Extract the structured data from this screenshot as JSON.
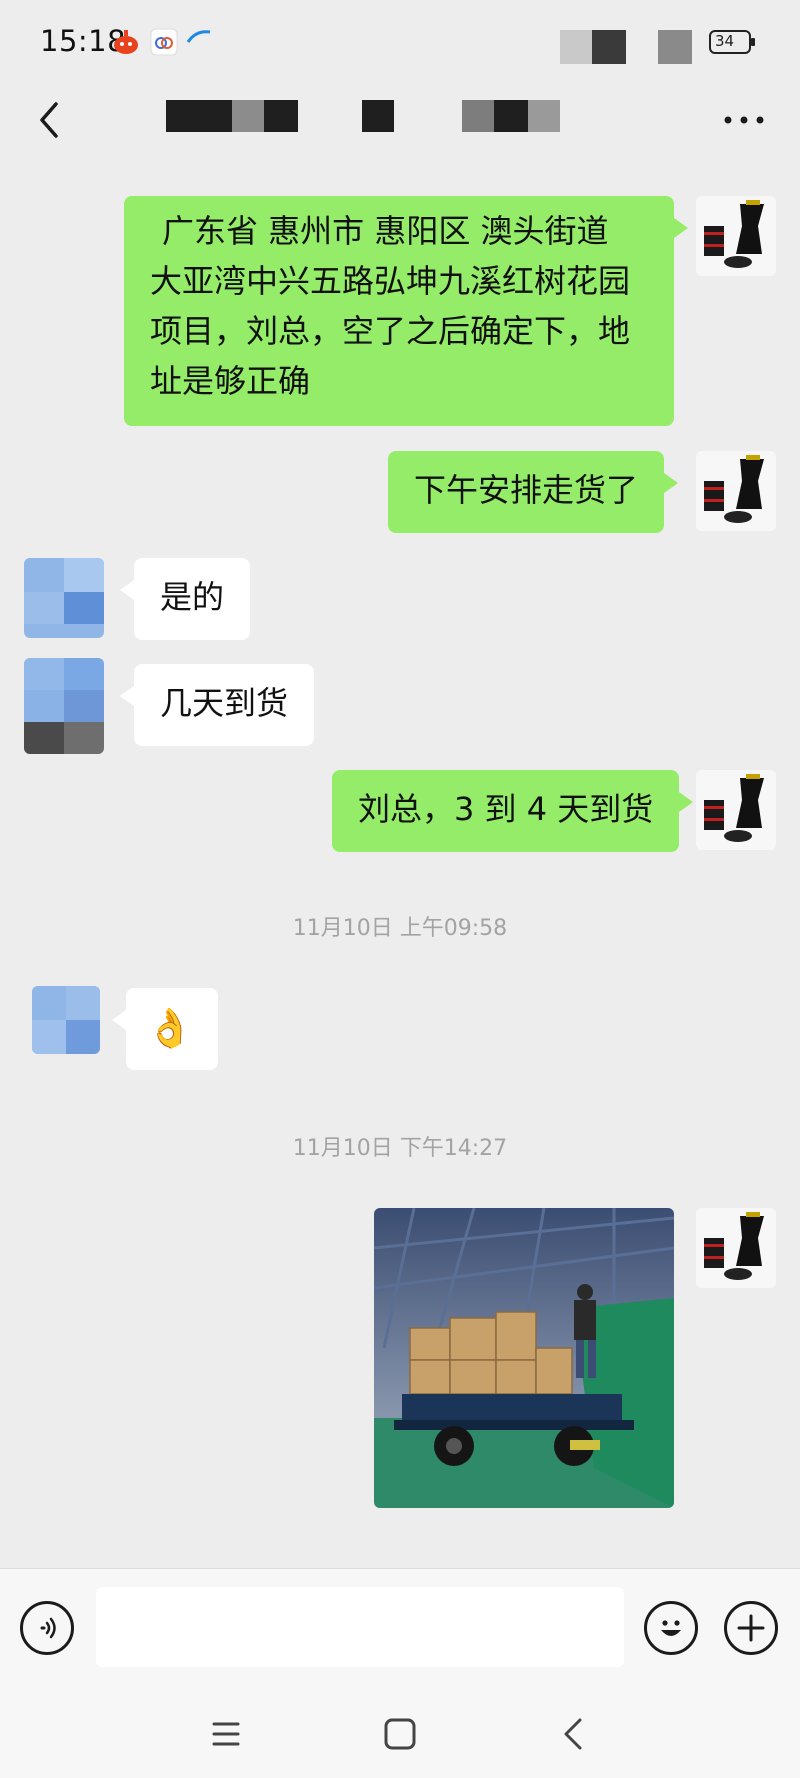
{
  "status_bar": {
    "time": "15:18",
    "battery": "34"
  },
  "chat": {
    "messages": [
      {
        "side": "sent",
        "text": "广东省 惠州市 惠阳区 澳头街道 大亚湾中兴五路弘坤九溪红树花园项目，刘总，空了之后确定下，地址是够正确"
      },
      {
        "side": "sent",
        "text": "下午安排走货了"
      },
      {
        "side": "received",
        "text": "是的"
      },
      {
        "side": "received",
        "text": "几天到货"
      },
      {
        "side": "sent",
        "text": "刘总，3 到 4 天到货"
      },
      {
        "side": "received",
        "emoji": "👌"
      },
      {
        "side": "sent",
        "image": "truck-loading-photo"
      }
    ],
    "lines": {
      "m0_l1": "广东省 惠州市 惠阳区 澳头街道",
      "m0_l2": "大亚湾中兴五路弘坤九溪红树花园",
      "m0_l3": "项目，刘总，空了之后确定下，地",
      "m0_l4": "址是够正确"
    },
    "timestamps": [
      "11月10日 上午09:58",
      "11月10日 下午14:27"
    ]
  },
  "input_bar": {
    "placeholder": ""
  },
  "colors": {
    "sent_bubble": "#95ec69",
    "received_bubble": "#ffffff",
    "background": "#ededed"
  },
  "icons": {
    "back": "chevron-left-icon",
    "more": "more-dots-icon",
    "voice": "voice-icon",
    "emoji": "emoji-smile-icon",
    "add": "plus-icon"
  }
}
